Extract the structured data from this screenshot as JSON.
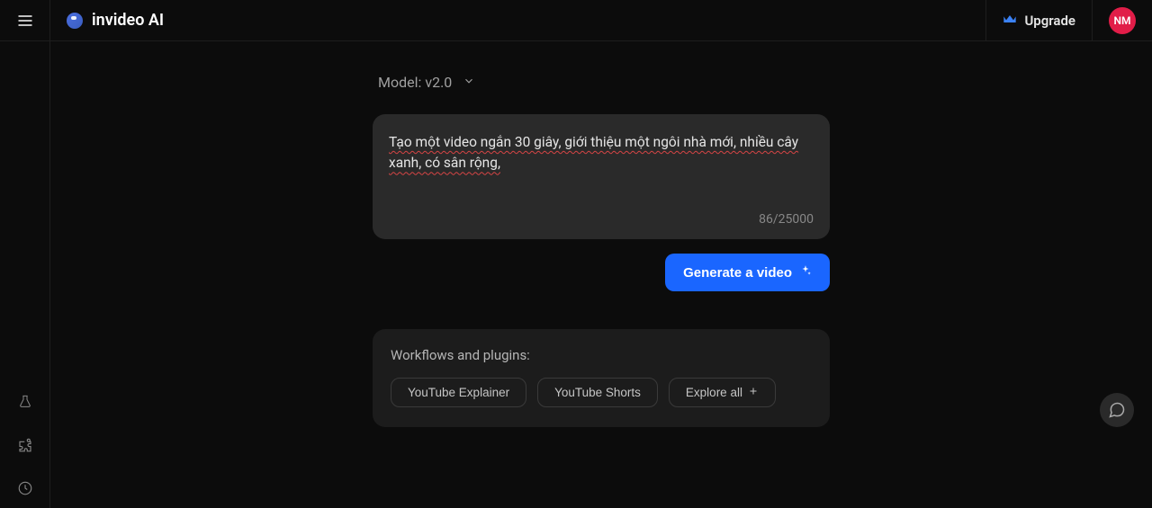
{
  "header": {
    "brand": "invideo AI",
    "upgrade": "Upgrade",
    "avatar_initials": "NM"
  },
  "model": {
    "label": "Model: v2.0"
  },
  "prompt": {
    "text": "Tạo một video ngắn 30 giây, giới thiệu một ngôi nhà mới, nhiều cây xanh, có sân rộng,",
    "count": "86/25000"
  },
  "actions": {
    "generate": "Generate a video"
  },
  "workflows": {
    "title": "Workflows and plugins:",
    "items": [
      "YouTube Explainer",
      "YouTube Shorts"
    ],
    "explore": "Explore all"
  }
}
